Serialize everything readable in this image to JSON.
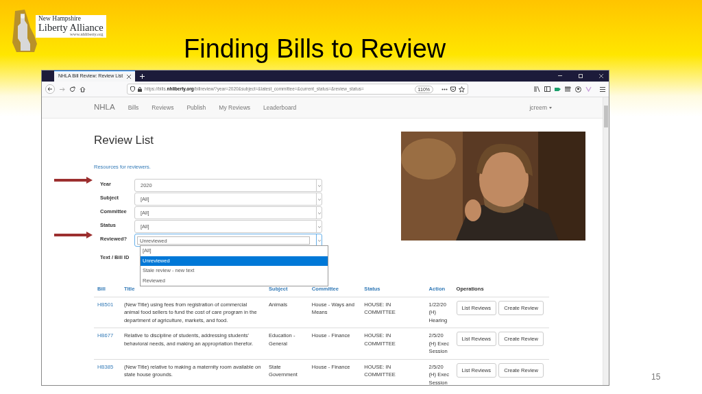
{
  "slide": {
    "logo": {
      "lines": [
        "New Hampshire",
        "Liberty Alliance",
        "www.nhliberty.org"
      ]
    },
    "title": "Finding Bills to Review",
    "page_number": "15"
  },
  "browser": {
    "tab_title": "NHLA Bill Review: Review List",
    "url": "https://bills.**nhliberty.org**/billreview/?year=2020&subject=&latest_committee=&current_status=&review_status=",
    "zoom": "110%"
  },
  "navbar": {
    "brand": "NHLA",
    "links": [
      "Bills",
      "Reviews",
      "Publish",
      "My Reviews",
      "Leaderboard"
    ],
    "user": "jcreem"
  },
  "page": {
    "heading": "Review List",
    "resources_link": "Resources for reviewers.",
    "filters": [
      {
        "label": "Year",
        "value": "2020",
        "expanded": false,
        "marked": true
      },
      {
        "label": "Subject",
        "value": "[All]",
        "expanded": false,
        "marked": false
      },
      {
        "label": "Committee",
        "value": "[All]",
        "expanded": false,
        "marked": false
      },
      {
        "label": "Status",
        "value": "[All]",
        "expanded": false,
        "marked": false
      },
      {
        "label": "Reviewed?",
        "value": "Unreviewed",
        "expanded": true,
        "marked": true
      }
    ],
    "text_filter_label": "Text / Bill ID",
    "dropdown_options": [
      {
        "label": "[All]",
        "selected": false
      },
      {
        "label": "Unreviewed",
        "selected": true
      },
      {
        "label": "Stale review - new text",
        "selected": false
      },
      {
        "label": "Reviewed",
        "selected": false
      }
    ]
  },
  "table": {
    "columns": [
      {
        "label": "Bill",
        "sortable": true
      },
      {
        "label": "Title",
        "sortable": true
      },
      {
        "label": "Subject",
        "sortable": true
      },
      {
        "label": "Committee",
        "sortable": true
      },
      {
        "label": "Status",
        "sortable": true
      },
      {
        "label": "Action",
        "sortable": true
      },
      {
        "label": "Operations",
        "sortable": false
      }
    ],
    "rows": [
      {
        "bill": "HB501",
        "title": "(New Title) using fees from registration of commercial animal food sellers to fund the cost of care program in the department of agriculture, markets, and food.",
        "subject": "Animals",
        "committee": "House - Ways and Means",
        "status": "HOUSE: IN COMMITTEE",
        "action": "1/22/20 (H) Hearing",
        "buttons": [
          "List Reviews",
          "Create Review"
        ]
      },
      {
        "bill": "HB677",
        "title": "Relative to discipline of students, addressing students' behavioral needs, and making an appropriation therefor.",
        "subject": "Education - General",
        "committee": "House - Finance",
        "status": "HOUSE: IN COMMITTEE",
        "action": "2/5/20 (H) Exec Session",
        "buttons": [
          "List Reviews",
          "Create Review"
        ]
      },
      {
        "bill": "HB385",
        "title": "(New Title) relative to making a maternity room available on state house grounds.",
        "subject": "State Government",
        "committee": "House - Finance",
        "status": "HOUSE: IN COMMITTEE",
        "action": "2/5/20 (H) Exec Session",
        "buttons": [
          "List Reviews",
          "Create Review"
        ]
      }
    ]
  }
}
